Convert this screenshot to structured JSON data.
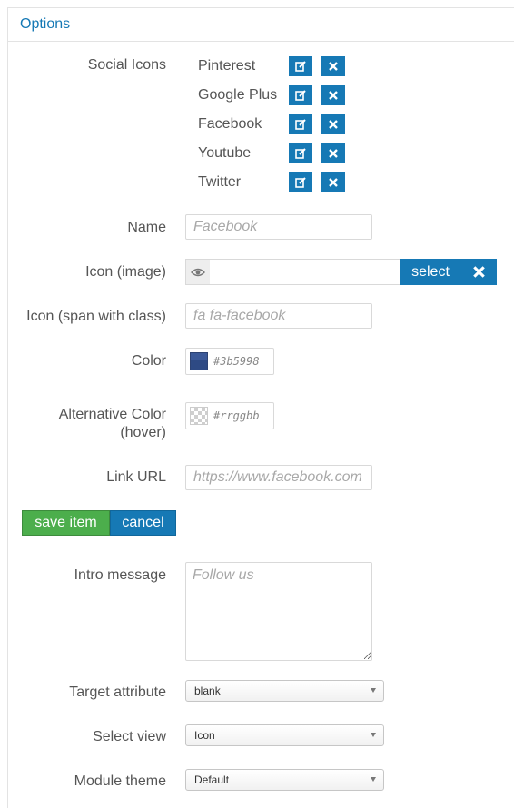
{
  "panel": {
    "title": "Options"
  },
  "social_icons": {
    "label": "Social Icons",
    "items": [
      {
        "name": "Pinterest"
      },
      {
        "name": "Google Plus"
      },
      {
        "name": "Facebook"
      },
      {
        "name": "Youtube"
      },
      {
        "name": "Twitter"
      }
    ]
  },
  "form": {
    "name": {
      "label": "Name",
      "placeholder": "Facebook"
    },
    "icon_image": {
      "label": "Icon (image)",
      "value": "",
      "select_label": "select"
    },
    "icon_span": {
      "label": "Icon (span with class)",
      "placeholder": "fa fa-facebook"
    },
    "color": {
      "label": "Color",
      "value": "#3b5998"
    },
    "alt_color": {
      "label_line1": "Alternative Color",
      "label_line2": "(hover)",
      "placeholder": "#rrggbb"
    },
    "link_url": {
      "label": "Link URL",
      "placeholder": "https://www.facebook.com"
    },
    "save_label": "save item",
    "cancel_label": "cancel",
    "intro": {
      "label": "Intro message",
      "placeholder": "Follow us"
    },
    "target": {
      "label": "Target attribute",
      "value": "blank"
    },
    "view": {
      "label": "Select view",
      "value": "Icon"
    },
    "theme": {
      "label": "Module theme",
      "value": "Default"
    }
  },
  "colors": {
    "accent": "#1679b5",
    "save": "#4cae4c",
    "swatch": "#3b5998"
  }
}
